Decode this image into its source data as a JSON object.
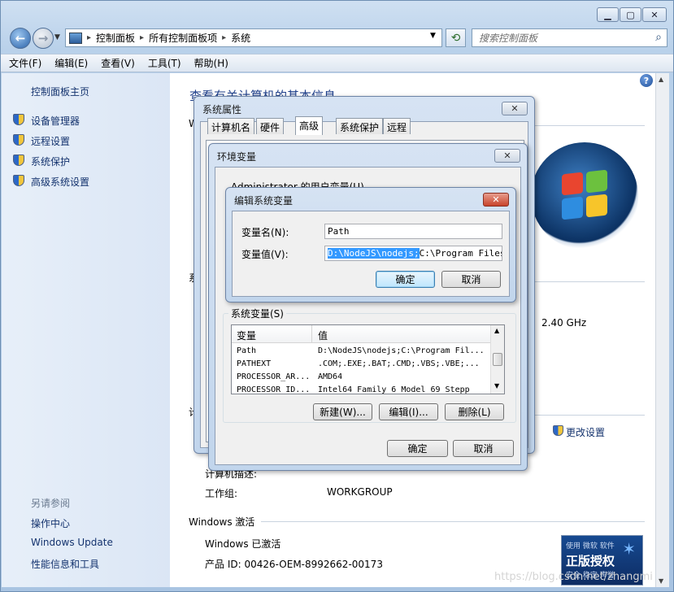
{
  "address": {
    "segments": [
      "控制面板",
      "所有控制面板项",
      "系统"
    ],
    "search_placeholder": "搜索控制面板"
  },
  "menu": [
    "文件(F)",
    "编辑(E)",
    "查看(V)",
    "工具(T)",
    "帮助(H)"
  ],
  "sidebar": {
    "home": "控制面板主页",
    "links": [
      "设备管理器",
      "远程设置",
      "系统保护",
      "高级系统设置"
    ],
    "see_also_title": "另请参阅",
    "see_also": [
      "操作中心",
      "Windows Update",
      "性能信息和工具"
    ]
  },
  "content": {
    "heading": "查看有关计算机的基本信息",
    "w_fragment": "W",
    "sys_fragment": "系",
    "ji_fragment": "计",
    "cpu_speed": "2.40 GHz",
    "change_settings": "更改设置",
    "desc_label": "计算机描述:",
    "workgroup_label": "工作组:",
    "workgroup_value": "WORKGROUP",
    "activation_title": "Windows 激活",
    "activation_status": "Windows 已激活",
    "product_id": "产品 ID: 00426-OEM-8992662-00173"
  },
  "genuine": {
    "line1": "使用 微软 软件",
    "line2": "正版授权",
    "line3": "安全 稳定 声誉"
  },
  "watermark": "https://blog.csdn.net/zhangmi",
  "sysprops": {
    "title": "系统属性",
    "tabs": [
      "计算机名",
      "硬件",
      "高级",
      "系统保护",
      "远程"
    ]
  },
  "envvars": {
    "title": "环境变量",
    "user_vars_label": "Administrator 的用户变量(U)",
    "sys_vars_label": "系统变量(S)",
    "col_name": "变量",
    "col_value": "值",
    "rows": [
      {
        "name": "Path",
        "value": "D:\\NodeJS\\nodejs;C:\\Program Fil..."
      },
      {
        "name": "PATHEXT",
        "value": ".COM;.EXE;.BAT;.CMD;.VBS;.VBE;..."
      },
      {
        "name": "PROCESSOR_AR...",
        "value": "AMD64"
      },
      {
        "name": "PROCESSOR_ID...",
        "value": "Intel64 Family 6 Model 69 Stepp"
      }
    ],
    "new_btn": "新建(W)...",
    "edit_btn": "编辑(I)...",
    "delete_btn": "删除(L)",
    "ok": "确定",
    "cancel": "取消"
  },
  "editvar": {
    "title": "编辑系统变量",
    "name_label": "变量名(N):",
    "value_label": "变量值(V):",
    "name_value": "Path",
    "value_selected": "D:\\NodeJS\\nodejs;",
    "value_rest": "C:\\Program Files (",
    "ok": "确定",
    "cancel": "取消"
  }
}
